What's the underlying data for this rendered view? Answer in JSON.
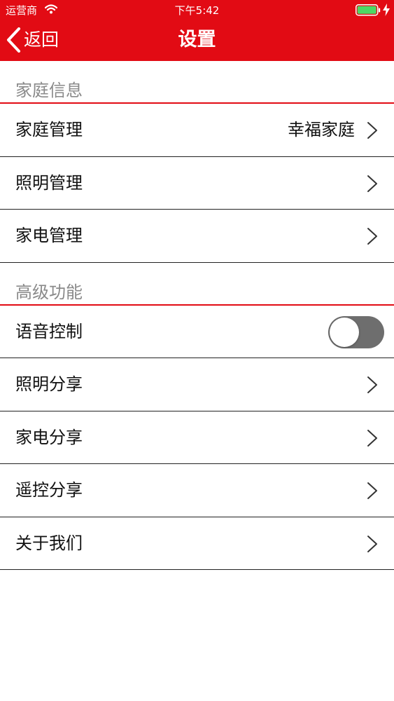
{
  "status_bar": {
    "carrier": "运营商",
    "time": "下午5:42",
    "icons": [
      "wifi-icon",
      "battery-icon",
      "charging-bolt-icon"
    ]
  },
  "nav_bar": {
    "back_label": "返回",
    "title": "设置",
    "background_color": "#e20b14"
  },
  "sections": [
    {
      "title": "家庭信息",
      "items": [
        {
          "label": "家庭管理",
          "value": "幸福家庭",
          "accessory": "chevron-right-icon"
        },
        {
          "label": "照明管理",
          "accessory": "chevron-right-icon"
        },
        {
          "label": "家电管理",
          "accessory": "chevron-right-icon"
        }
      ]
    },
    {
      "title": "高级功能",
      "items": [
        {
          "label": "语音控制",
          "accessory": "toggle",
          "toggle_on": false
        },
        {
          "label": "照明分享",
          "accessory": "chevron-right-icon"
        },
        {
          "label": "家电分享",
          "accessory": "chevron-right-icon"
        },
        {
          "label": "遥控分享",
          "accessory": "chevron-right-icon"
        },
        {
          "label": "关于我们",
          "accessory": "chevron-right-icon"
        }
      ]
    }
  ]
}
